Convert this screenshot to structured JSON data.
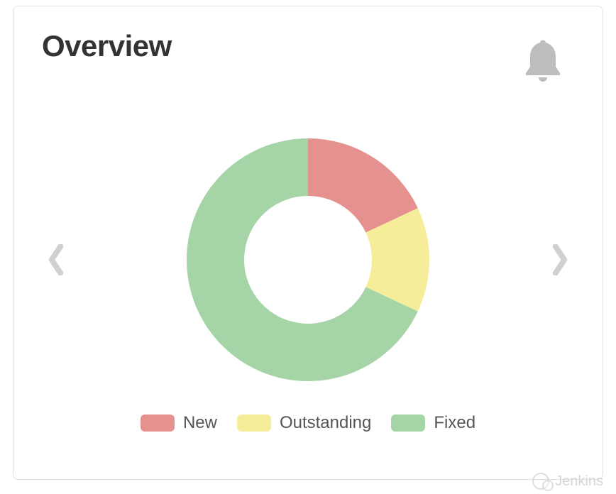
{
  "title": "Overview",
  "watermark": "Jenkins",
  "colors": {
    "new": "#e5918f",
    "outstanding": "#f6ed9a",
    "fixed": "#a5d4a6"
  },
  "chart_data": {
    "type": "pie",
    "title": "Overview",
    "series": [
      {
        "name": "New",
        "value": 18,
        "color": "#e5918f"
      },
      {
        "name": "Outstanding",
        "value": 14,
        "color": "#f6ed9a"
      },
      {
        "name": "Fixed",
        "value": 68,
        "color": "#a5d4a6"
      }
    ]
  },
  "legend": [
    {
      "label": "New",
      "colorKey": "new"
    },
    {
      "label": "Outstanding",
      "colorKey": "outstanding"
    },
    {
      "label": "Fixed",
      "colorKey": "fixed"
    }
  ]
}
